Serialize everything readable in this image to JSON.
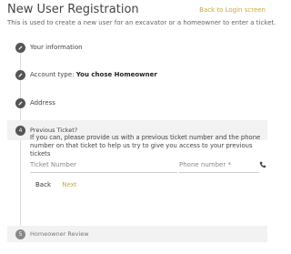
{
  "header": {
    "title": "New User Registration",
    "back_link": "Back to Login screen",
    "subtitle": "This is used to create a new user for an excavator or a homeowner to enter a ticket."
  },
  "steps": [
    {
      "label": "Your information",
      "icon": "pencil-icon",
      "state": "completed"
    },
    {
      "label": "Account type: ",
      "value": "You chose Homeowner",
      "icon": "pencil-icon",
      "state": "completed"
    },
    {
      "label": "Address",
      "icon": "pencil-icon",
      "state": "completed"
    },
    {
      "number": "4",
      "label": "Previous Ticket?",
      "state": "active"
    },
    {
      "number": "5",
      "label": "Homeowner Review",
      "state": "pending"
    }
  ],
  "previous_ticket": {
    "description": "If you can, please provide us with a previous ticket number and the phone number on that ticket to help us try to give you access to your previous tickets",
    "ticket_placeholder": "Ticket Number",
    "phone_placeholder": "Phone number *",
    "phone_icon": "phone-icon",
    "back_label": "Back",
    "next_label": "Next"
  },
  "colors": {
    "accent": "#c9a93a",
    "step_circle": "#555555",
    "active_row_bg": "#f2f2f2"
  }
}
